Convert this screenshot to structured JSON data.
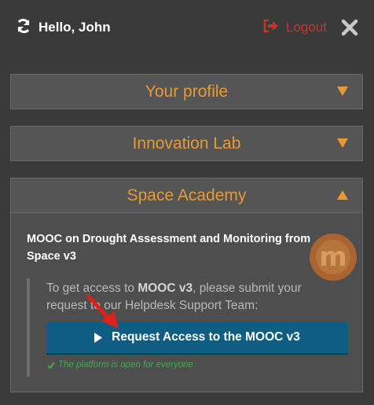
{
  "header": {
    "greeting": "Hello, John",
    "logout_label": "Logout",
    "icons": {
      "refresh": "refresh-icon",
      "logout": "logout-icon",
      "close": "close-icon"
    }
  },
  "panels": [
    {
      "title": "Your profile",
      "expanded": false
    },
    {
      "title": "Innovation Lab",
      "expanded": false
    },
    {
      "title": "Space Academy",
      "expanded": true,
      "course_title": "MOOC on Drought Assessment and Monitoring from Space v3",
      "badge_letter": "m",
      "info_prefix": "To get access to ",
      "info_bold": "MOOC v3",
      "info_suffix": ", please submit your request to our Helpdesk Support Team:",
      "button_label": "Request Access to the MOOC v3",
      "note": "The platform is open for everyone."
    }
  ],
  "colors": {
    "background": "#3a3a3a",
    "panel": "#555555",
    "accent": "#e89a32",
    "logout": "#c9332c",
    "button": "#0f5d83",
    "success": "#3fae4a",
    "annotation_arrow": "#e0201c"
  }
}
